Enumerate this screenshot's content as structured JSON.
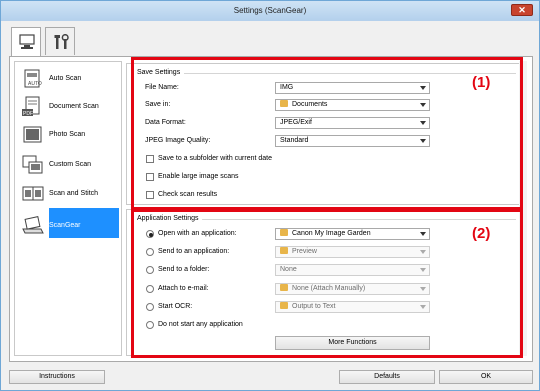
{
  "window": {
    "title": "Settings (ScanGear)",
    "close": "✕"
  },
  "sidebar": {
    "items": [
      {
        "label": "Auto Scan"
      },
      {
        "label": "Document Scan"
      },
      {
        "label": "Photo Scan"
      },
      {
        "label": "Custom Scan"
      },
      {
        "label": "Scan and Stitch"
      },
      {
        "label": "ScanGear"
      }
    ]
  },
  "save_settings": {
    "title": "Save Settings",
    "file_name_label": "File Name:",
    "file_name_value": "IMG",
    "save_in_label": "Save in:",
    "save_in_value": "Documents",
    "data_format_label": "Data Format:",
    "data_format_value": "JPEG/Exif",
    "jpeg_quality_label": "JPEG Image Quality:",
    "jpeg_quality_value": "Standard",
    "cb_subfolder": "Save to a subfolder with current date",
    "cb_large": "Enable large image scans",
    "cb_check": "Check scan results"
  },
  "app_settings": {
    "title": "Application Settings",
    "open_app_label": "Open with an application:",
    "open_app_value": "Canon My Image Garden",
    "send_app_label": "Send to an application:",
    "send_app_value": "Preview",
    "send_folder_label": "Send to a folder:",
    "send_folder_value": "None",
    "email_label": "Attach to e-mail:",
    "email_value": "None (Attach Manually)",
    "ocr_label": "Start OCR:",
    "ocr_value": "Output to Text",
    "none_label": "Do not start any application",
    "more_functions": "More Functions"
  },
  "annotations": {
    "mark1": "(1)",
    "mark2": "(2)"
  },
  "footer": {
    "instructions": "Instructions",
    "defaults": "Defaults",
    "ok": "OK"
  },
  "colors": {
    "highlight": "#e30613",
    "selection": "#1e90ff"
  }
}
